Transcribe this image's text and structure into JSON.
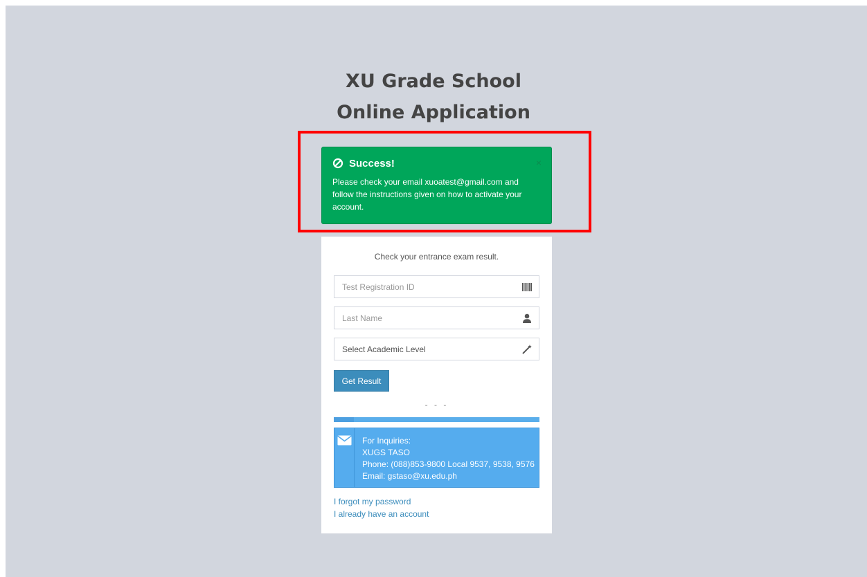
{
  "header": {
    "line1": "XU Grade School",
    "line2": "Online Application"
  },
  "alert": {
    "icon": "ban-circle-icon",
    "title": "Success!",
    "close": "×",
    "message": "Please check your email xuoatest@gmail.com and follow the instructions given on how to activate your account.",
    "color": "#00a65a"
  },
  "form": {
    "lead": "Check your entrance exam result.",
    "registration_id": {
      "placeholder": "Test Registration ID",
      "value": "",
      "icon": "barcode-icon"
    },
    "last_name": {
      "placeholder": "Last Name",
      "value": "",
      "icon": "user-icon"
    },
    "academic_level": {
      "selected": "Select Academic Level",
      "icon": "magic-wand-icon"
    },
    "submit_label": "Get Result",
    "separator": "- - -"
  },
  "inquiries": {
    "icon": "envelope-icon",
    "line1": "For Inquiries:",
    "line2": "XUGS TASO",
    "line3": "Phone: (088)853-9800 Local 9537, 9538, 9576",
    "line4": "Email: gstaso@xu.edu.ph",
    "color": "#55acee"
  },
  "links": {
    "forgot_password": "I forgot my password",
    "have_account": "I already have an account"
  },
  "colors": {
    "page_background": "#d2d6de",
    "primary": "#3c8dbc",
    "highlight": "#ff0000"
  }
}
